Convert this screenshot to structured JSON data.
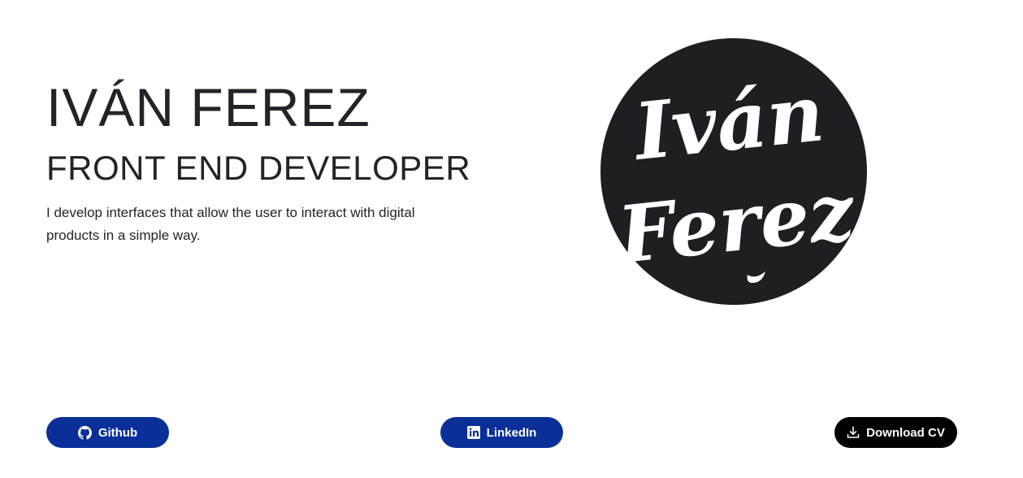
{
  "hero": {
    "name": "IVÁN FEREZ",
    "role": "FRONT END DEVELOPER",
    "description": "I develop interfaces that allow the user to interact with digital products in a simple way."
  },
  "logo": {
    "line1": "Iván",
    "line2": "Ferez",
    "bg_color": "#1d1f22",
    "text_color": "#ffffff"
  },
  "buttons": {
    "github": {
      "label": "Github",
      "icon": "github-icon",
      "color": "#0a2f99"
    },
    "linkedin": {
      "label": "LinkedIn",
      "icon": "linkedin-icon",
      "color": "#0a2f99"
    },
    "download_cv": {
      "label": "Download CV",
      "icon": "download-icon",
      "color": "#000000"
    }
  }
}
